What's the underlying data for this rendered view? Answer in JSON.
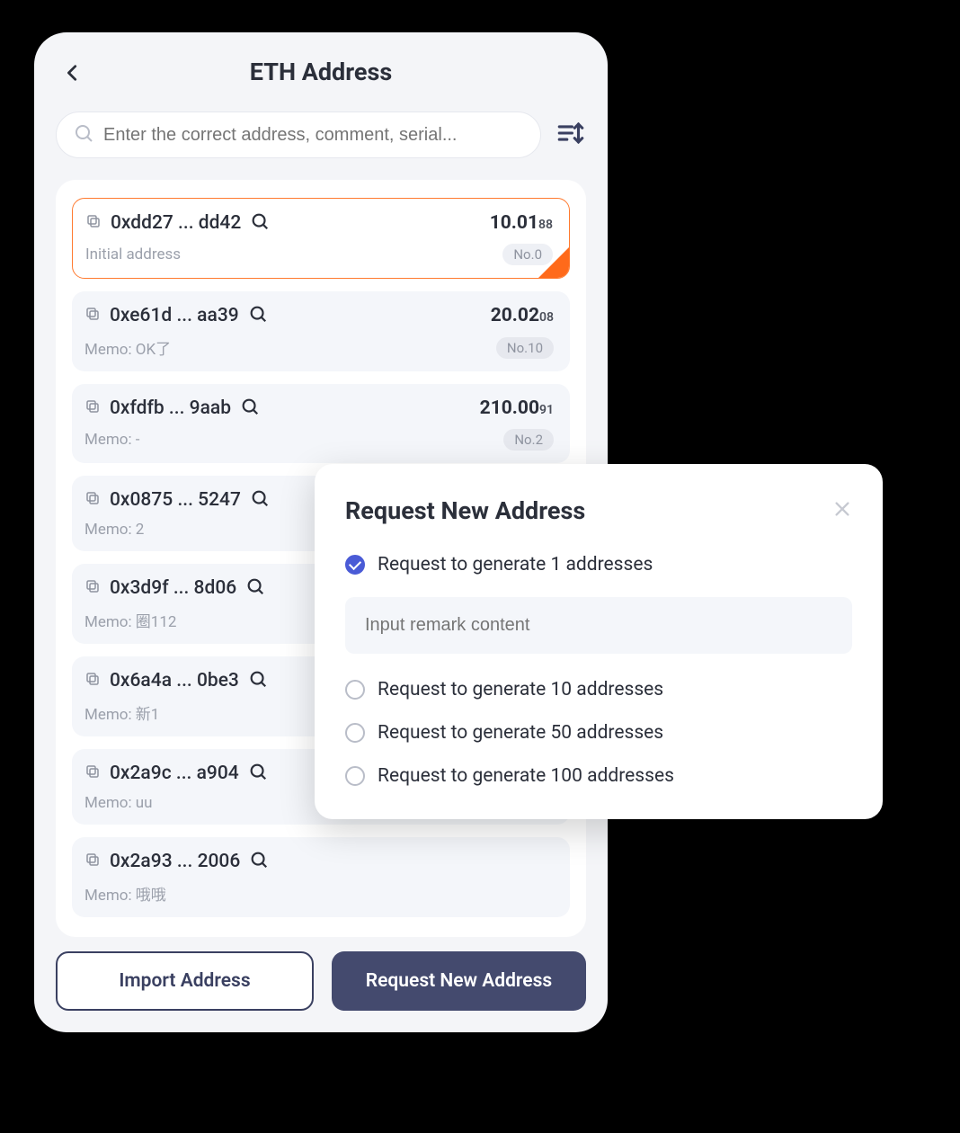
{
  "header": {
    "title": "ETH Address"
  },
  "search": {
    "placeholder": "Enter the correct address, comment, serial..."
  },
  "addresses": [
    {
      "addr": "0xdd27 ... dd42",
      "balance_int": "10.01",
      "balance_dec": "88",
      "memo": "Initial address",
      "badge": "No.0",
      "selected": true
    },
    {
      "addr": "0xe61d ... aa39",
      "balance_int": "20.02",
      "balance_dec": "08",
      "memo": "Memo: OK了",
      "badge": "No.10",
      "selected": false
    },
    {
      "addr": "0xfdfb ... 9aab",
      "balance_int": "210.00",
      "balance_dec": "91",
      "memo": "Memo: -",
      "badge": "No.2",
      "selected": false
    },
    {
      "addr": "0x0875 ... 5247",
      "balance_int": "",
      "balance_dec": "",
      "memo": "Memo: 2",
      "badge": "",
      "selected": false
    },
    {
      "addr": "0x3d9f ... 8d06",
      "balance_int": "",
      "balance_dec": "",
      "memo": "Memo: 圈112",
      "badge": "",
      "selected": false
    },
    {
      "addr": "0x6a4a ... 0be3",
      "balance_int": "",
      "balance_dec": "",
      "memo": "Memo: 新1",
      "badge": "",
      "selected": false
    },
    {
      "addr": "0x2a9c ... a904",
      "balance_int": "",
      "balance_dec": "",
      "memo": "Memo: uu",
      "badge": "",
      "selected": false
    },
    {
      "addr": "0x2a93 ... 2006",
      "balance_int": "",
      "balance_dec": "",
      "memo": "Memo: 哦哦",
      "badge": "",
      "selected": false
    }
  ],
  "buttons": {
    "import": "Import Address",
    "request": "Request New Address"
  },
  "modal": {
    "title": "Request New Address",
    "remark_placeholder": "Input remark content",
    "options": [
      {
        "label": "Request to generate 1 addresses",
        "checked": true
      },
      {
        "label": "Request to generate 10 addresses",
        "checked": false
      },
      {
        "label": "Request to generate 50 addresses",
        "checked": false
      },
      {
        "label": "Request to generate 100 addresses",
        "checked": false
      }
    ]
  }
}
